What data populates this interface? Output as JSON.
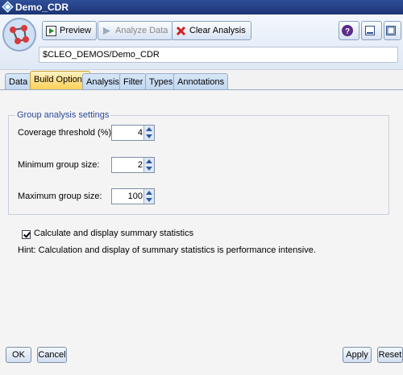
{
  "window": {
    "title": "Demo_CDR"
  },
  "toolbar": {
    "preview_label": "Preview",
    "analyze_label": "Analyze Data",
    "clear_label": "Clear Analysis"
  },
  "path": "$CLEO_DEMOS/Demo_CDR",
  "tabs": [
    {
      "label": "Data"
    },
    {
      "label": "Build Options",
      "active": true
    },
    {
      "label": "Analysis"
    },
    {
      "label": "Filter"
    },
    {
      "label": "Types"
    },
    {
      "label": "Annotations"
    }
  ],
  "group": {
    "legend": "Group analysis settings",
    "coverage_label": "Coverage threshold (%):",
    "coverage_value": "4",
    "min_label": "Minimum group size:",
    "min_value": "2",
    "max_label": "Maximum group size:",
    "max_value": "100"
  },
  "summary": {
    "checked": true,
    "label": "Calculate and display summary statistics",
    "hint": "Hint: Calculation and display of summary statistics is performance intensive."
  },
  "footer": {
    "ok": "OK",
    "cancel": "Cancel",
    "apply": "Apply",
    "reset": "Reset"
  },
  "colors": {
    "titlebar": "#1c3474",
    "active_tab": "#ffcf52",
    "legend": "#2b4a9a"
  },
  "icons": [
    "app-icon",
    "node-icon",
    "preview-icon",
    "analyze-icon",
    "clear-icon",
    "help-icon",
    "minimize-icon",
    "maximize-icon"
  ]
}
